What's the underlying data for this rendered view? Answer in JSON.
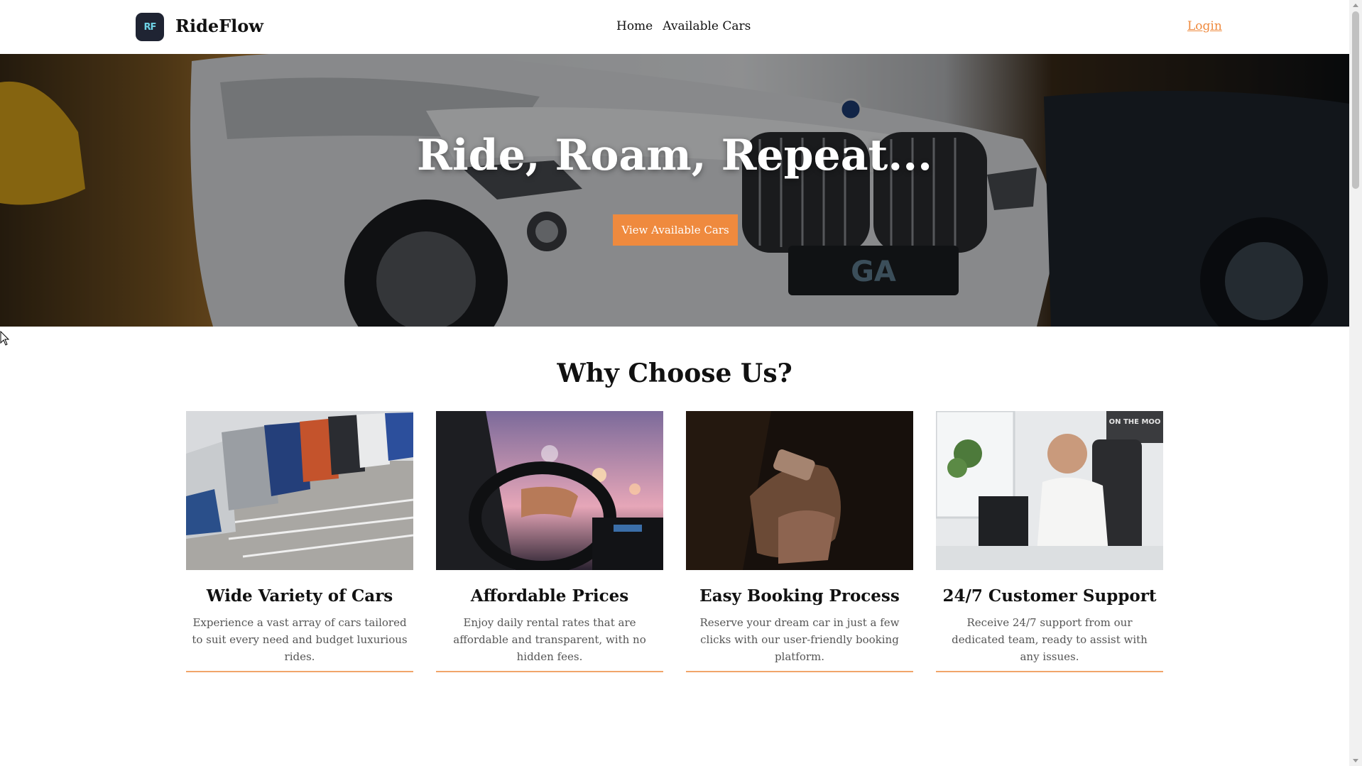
{
  "header": {
    "logo_mark": "RF",
    "brand": "RideFlow",
    "nav": [
      "Home",
      "Available Cars"
    ],
    "login": "Login"
  },
  "hero": {
    "title": "Ride, Roam, Repeat...",
    "button": "View Available Cars"
  },
  "features": {
    "title": "Why Choose Us?",
    "cards": [
      {
        "title": "Wide Variety of Cars",
        "text": "Experience a vast array of cars tailored to suit every need and budget luxurious rides.",
        "image": "parked-cars-image"
      },
      {
        "title": "Affordable Prices",
        "text": "Enjoy daily rental rates that are affordable and transparent, with no hidden fees.",
        "image": "driving-image"
      },
      {
        "title": "Easy Booking Process",
        "text": "Reserve your dream car in just a few clicks with our user-friendly booking platform.",
        "image": "phone-booking-image"
      },
      {
        "title": "24/7 Customer Support",
        "text": "Receive 24/7 support from our dedicated team, ready to assist with any issues.",
        "image": "support-agent-image"
      }
    ]
  },
  "colors": {
    "accent": "#ef8a3e",
    "logo_bg": "#1f2433"
  }
}
